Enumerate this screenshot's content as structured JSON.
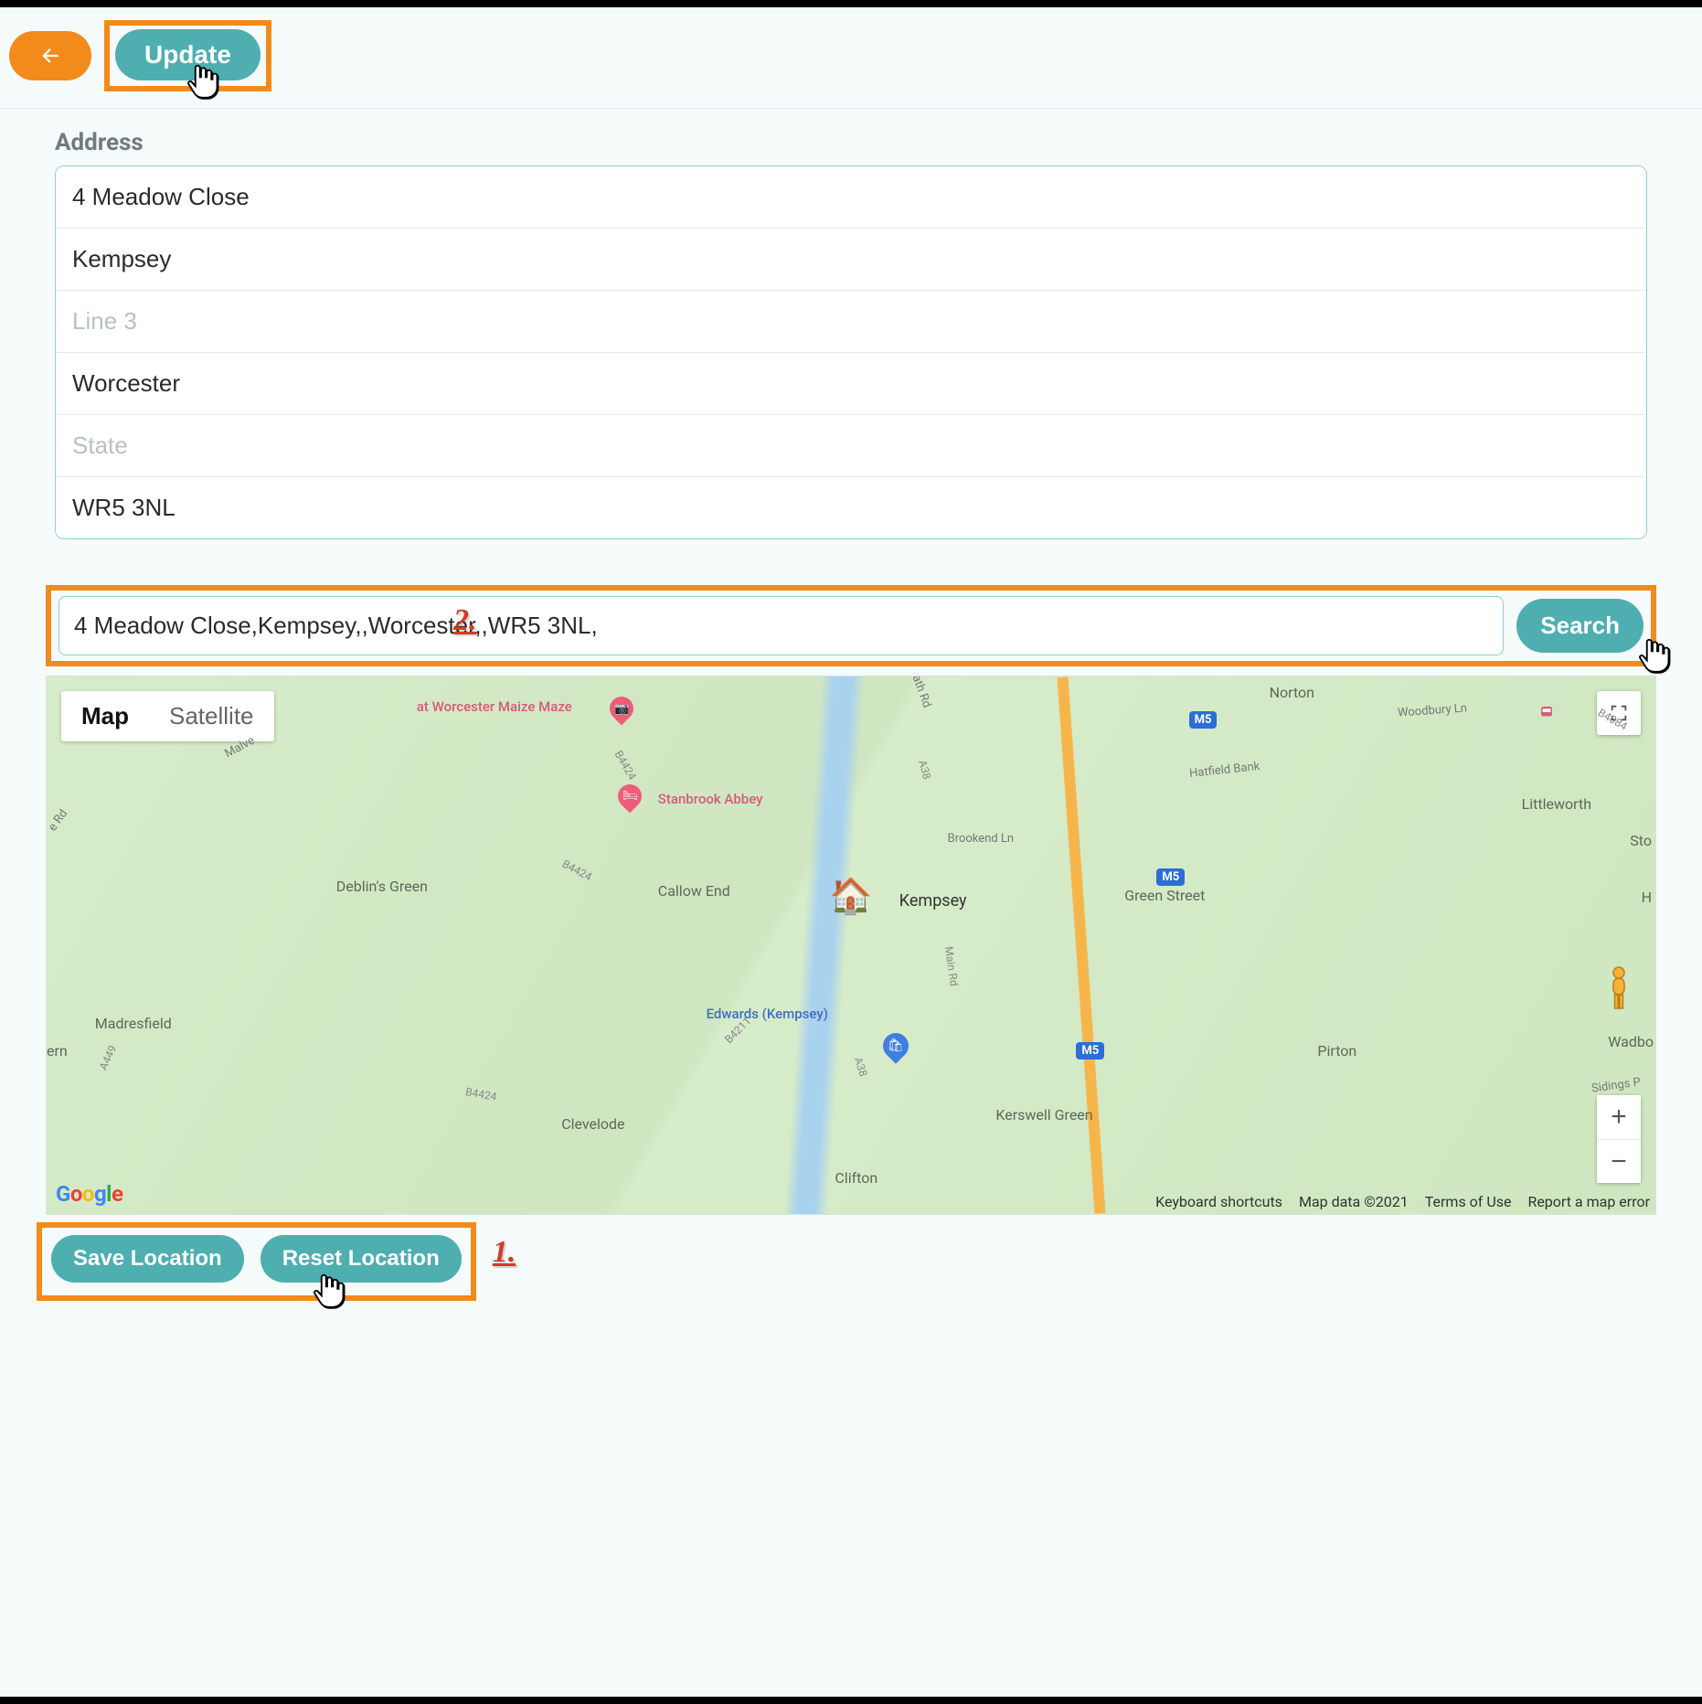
{
  "topbar": {
    "update_label": "Update"
  },
  "address": {
    "heading": "Address",
    "line1": "4 Meadow Close",
    "line2": "Kempsey",
    "line3": "",
    "line3_placeholder": "Line 3",
    "city": "Worcester",
    "state": "",
    "state_placeholder": "State",
    "postcode": "WR5 3NL"
  },
  "search": {
    "value": "4 Meadow Close,Kempsey,,Worcester,,WR5 3NL,",
    "button": "Search"
  },
  "annotations": {
    "step1": "1.",
    "step2": "2."
  },
  "map": {
    "type_map": "Map",
    "type_satellite": "Satellite",
    "zoom_in": "+",
    "zoom_out": "−",
    "labels": {
      "norton": "Norton",
      "littleworth": "Littleworth",
      "sto": "Sto",
      "green_street": "Green Street",
      "h": "H",
      "pirton": "Pirton",
      "wadbo": "Wadbo",
      "kerswell": "Kerswell Green",
      "clifton": "Clifton",
      "clevelode": "Clevelode",
      "madresfield": "Madresfield",
      "ern": "ern",
      "deblins": "Deblin's Green",
      "callow": "Callow End",
      "kempsey": "Kempsey",
      "edwards": "Edwards (Kempsey)",
      "stanbrook": "Stanbrook Abbey",
      "maize": "at Worcester Maize Maze",
      "brookend": "Brookend Ln",
      "hatfield": "Hatfield Bank",
      "woodbury": "Woodbury Ln",
      "sidings": "Sidings P",
      "malve": "Malve",
      "m5": "M5",
      "a38": "A38",
      "a449": "A449",
      "b4084": "B4084",
      "b4211": "B4211",
      "b4424": "B4424",
      "mainrd": "Main Rd",
      "bath": "Bath Rd",
      "eRd": "e Rd"
    },
    "footer": {
      "shortcuts": "Keyboard shortcuts",
      "mapdata": "Map data ©2021",
      "terms": "Terms of Use",
      "report": "Report a map error"
    },
    "google": "Google"
  },
  "bottom": {
    "save": "Save Location",
    "reset": "Reset Location"
  }
}
